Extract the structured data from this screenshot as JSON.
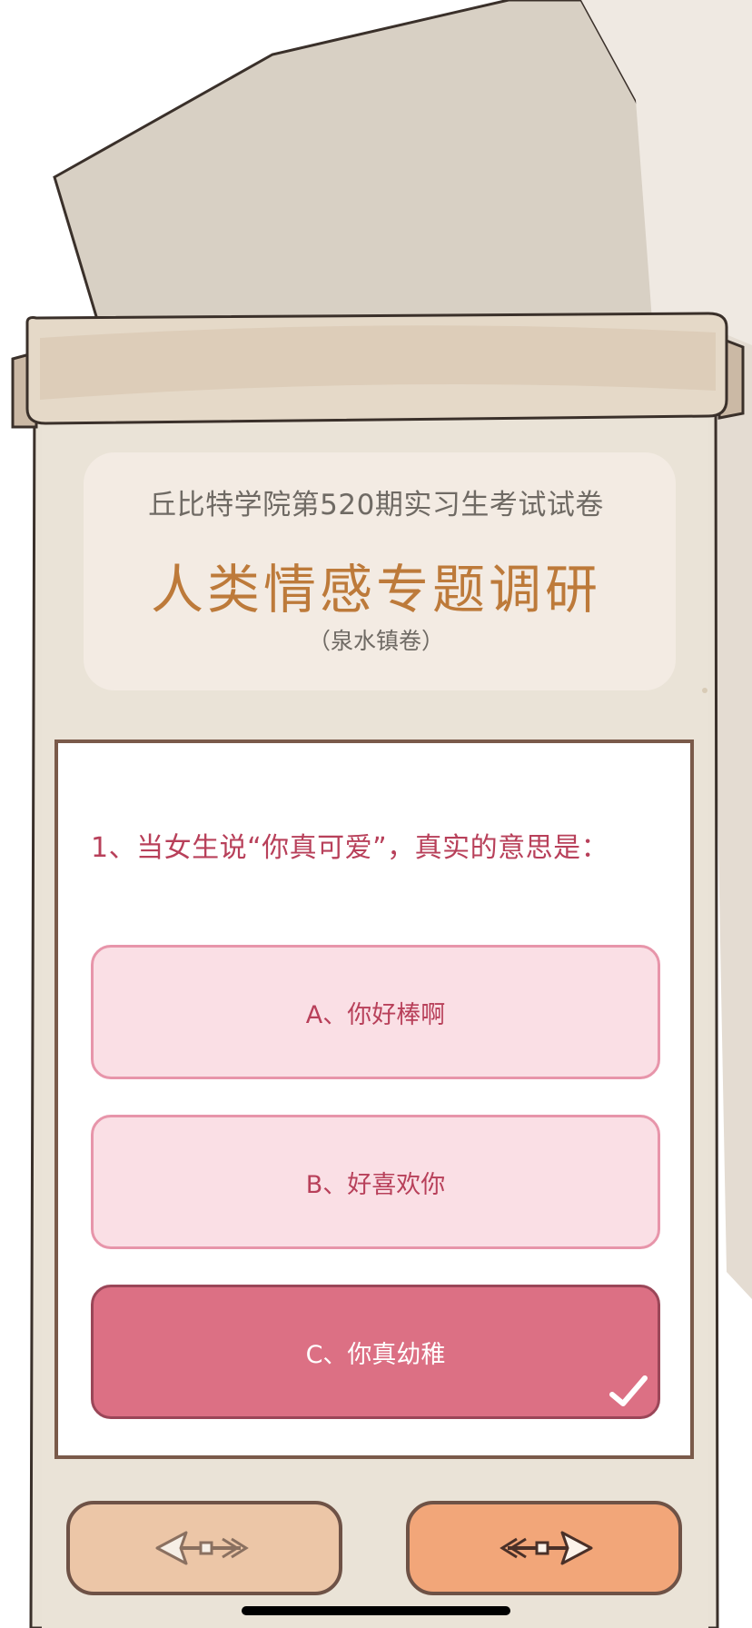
{
  "exam": {
    "subtitle": "丘比特学院第520期实习生考试试卷",
    "title": "人类情感专题调研",
    "edition": "（泉水镇卷）"
  },
  "question": {
    "text": "1、当女生说“你真可爱”，真实的意思是：",
    "options": [
      {
        "label": "A、你好棒啊",
        "selected": false
      },
      {
        "label": "B、好喜欢你",
        "selected": false
      },
      {
        "label": "C、你真幼稚",
        "selected": true
      }
    ],
    "selected_icon": "check-icon"
  },
  "navigation": {
    "prev_icon": "arrow-left-icon",
    "next_icon": "arrow-right-icon"
  },
  "colors": {
    "title": "#bd7a3a",
    "question": "#b8405a",
    "option_fill": "#fadfe5",
    "option_selected": "#dc7084",
    "prev_button": "#ecc6a7",
    "next_button": "#f2a679"
  }
}
